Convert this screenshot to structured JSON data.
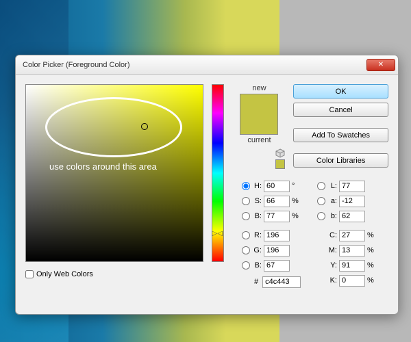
{
  "dialog": {
    "title": "Color Picker (Foreground Color)",
    "close": "✕"
  },
  "buttons": {
    "ok": "OK",
    "cancel": "Cancel",
    "add_swatches": "Add To Swatches",
    "color_libraries": "Color Libraries"
  },
  "labels": {
    "new": "new",
    "current": "current",
    "only_web": "Only Web Colors",
    "annotation": "use colors around this area"
  },
  "fields": {
    "H": {
      "label": "H:",
      "value": "60",
      "unit": "°"
    },
    "S": {
      "label": "S:",
      "value": "66",
      "unit": "%"
    },
    "Bv": {
      "label": "B:",
      "value": "77",
      "unit": "%"
    },
    "R": {
      "label": "R:",
      "value": "196",
      "unit": ""
    },
    "G": {
      "label": "G:",
      "value": "196",
      "unit": ""
    },
    "Bb": {
      "label": "B:",
      "value": "67",
      "unit": ""
    },
    "L": {
      "label": "L:",
      "value": "77",
      "unit": ""
    },
    "a": {
      "label": "a:",
      "value": "-12",
      "unit": ""
    },
    "b": {
      "label": "b:",
      "value": "62",
      "unit": ""
    },
    "C": {
      "label": "C:",
      "value": "27",
      "unit": "%"
    },
    "M": {
      "label": "M:",
      "value": "13",
      "unit": "%"
    },
    "Y": {
      "label": "Y:",
      "value": "91",
      "unit": "%"
    },
    "K": {
      "label": "K:",
      "value": "0",
      "unit": "%"
    },
    "hex": {
      "label": "#",
      "value": "c4c443"
    }
  },
  "colors": {
    "new": "#c4c443",
    "current": "#c4c443",
    "hue": "yellow"
  }
}
